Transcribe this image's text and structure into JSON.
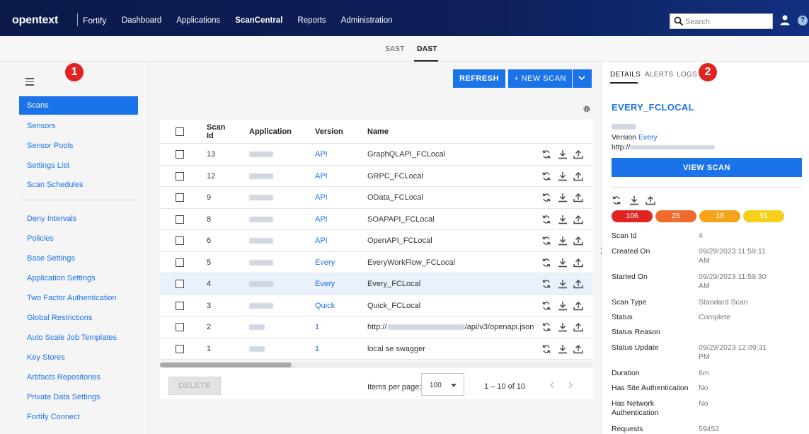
{
  "topbar": {
    "brand": "opentext",
    "product": "Fortify",
    "nav": [
      "Dashboard",
      "Applications",
      "ScanCentral",
      "Reports",
      "Administration"
    ],
    "active_nav": "ScanCentral",
    "search_placeholder": "Search"
  },
  "subtabs": [
    "SAST",
    "DAST"
  ],
  "sidebar": {
    "badge": "1",
    "items_top": [
      "Scans",
      "Sensors",
      "Sensor Pools",
      "Settings List",
      "Scan Schedules"
    ],
    "items_bottom": [
      "Deny Intervals",
      "Policies",
      "Base Settings",
      "Application Settings",
      "Two Factor Authentication",
      "Global Restrictions",
      "Auto Scale Job Templates",
      "Key Stores",
      "Artifacts Repositories",
      "Private Data Settings",
      "Fortify Connect"
    ]
  },
  "toolbar": {
    "refresh": "REFRESH",
    "new_scan": "+ NEW SCAN"
  },
  "table": {
    "headers": [
      "Scan Id",
      "Application",
      "Version",
      "Name"
    ],
    "rows": [
      {
        "id": "13",
        "version": "API",
        "name": "GraphQLAPI_FCLocal"
      },
      {
        "id": "12",
        "version": "API",
        "name": "GRPC_FCLocal"
      },
      {
        "id": "9",
        "version": "API",
        "name": "OData_FCLocal"
      },
      {
        "id": "8",
        "version": "API",
        "name": "SOAPAPI_FCLocal"
      },
      {
        "id": "6",
        "version": "API",
        "name": "OpenAPI_FCLocal"
      },
      {
        "id": "5",
        "version": "Every",
        "name": "EveryWorkFlow_FCLocal"
      },
      {
        "id": "4",
        "version": "Every",
        "name": "Every_FCLocal"
      },
      {
        "id": "3",
        "version": "Quick",
        "name": "Quick_FCLocal"
      },
      {
        "id": "2",
        "version": "1",
        "name_prefix": "http://",
        "name_suffix": "/api/v3/openapi.json"
      },
      {
        "id": "1",
        "version": "1",
        "name": "local se swagger"
      }
    ]
  },
  "pager": {
    "delete": "DELETE",
    "items_per_page_label": "Items per page:",
    "items_per_page": "100",
    "range": "1 – 10 of 10"
  },
  "panel": {
    "tabs": [
      "DETAILS",
      "ALERTS",
      "LOGS"
    ],
    "badge": "2",
    "title": "EVERY_FCLOCAL",
    "version_label": "Version",
    "version_value": "Every",
    "url_prefix": "http://",
    "view_scan": "VIEW SCAN",
    "counts": [
      "106",
      "25",
      "18",
      "91"
    ],
    "count_colors": [
      "#e02424",
      "#ef6c2e",
      "#f5a31a",
      "#f5cf1a"
    ],
    "details": [
      {
        "label": "Scan Id",
        "value": "4"
      },
      {
        "label": "Created On",
        "value": "09/29/2023 11:59:11 AM"
      },
      {
        "label": "Started On",
        "value": "09/29/2023 11:59:30 AM"
      },
      {
        "label": "Scan Type",
        "value": "Standard Scan"
      },
      {
        "label": "Status",
        "value": "Complete"
      },
      {
        "label": "Status Reason",
        "value": ""
      },
      {
        "label": "Status Update",
        "value": "09/29/2023 12:09:31 PM"
      },
      {
        "label": "Duration",
        "value": "6m"
      },
      {
        "label": "Has Site Authentication",
        "value": "No"
      },
      {
        "label": "Has Network Authentication",
        "value": "No"
      },
      {
        "label": "Requests",
        "value": "59452"
      }
    ]
  }
}
